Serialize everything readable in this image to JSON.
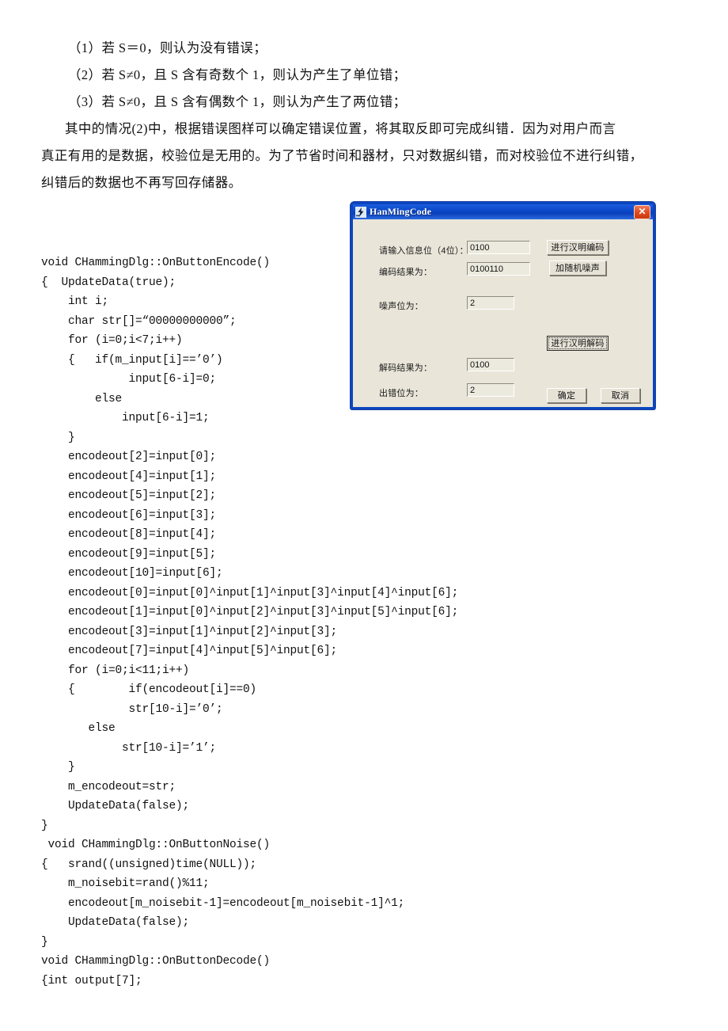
{
  "document": {
    "prose_lines": [
      {
        "text": "（1）若 S＝0，则认为没有错误；",
        "indent": "indent2"
      },
      {
        "text": "（2）若 S≠0，且 S 含有奇数个 1，则认为产生了单位错；",
        "indent": "indent2"
      },
      {
        "text": "（3）若 S≠0，且 S 含有偶数个 1，则认为产生了两位错；",
        "indent": "indent2"
      },
      {
        "text": "其中的情况(2)中，根据错误图样可以确定错误位置，将其取反即可完成纠错．因为对用户而言",
        "indent": "indent1"
      },
      {
        "text": "真正有用的是数据，校验位是无用的。为了节省时间和器材，只对数据纠错，而对校验位不进行纠错，",
        "indent": "flush"
      },
      {
        "text": "纠错后的数据也不再写回存储器。",
        "indent": "flush"
      }
    ],
    "code_lines": [
      "void CHammingDlg::OnButtonEncode()",
      "{  UpdateData(true);",
      "    int i;",
      "    char str[]=“00000000000”;",
      "    for (i=0;i<7;i++)",
      "    {   if(m_input[i]==’0’)",
      "             input[6-i]=0;",
      "        else",
      "            input[6-i]=1;",
      "    }",
      "    encodeout[2]=input[0];",
      "    encodeout[4]=input[1];",
      "    encodeout[5]=input[2];",
      "    encodeout[6]=input[3];",
      "    encodeout[8]=input[4];",
      "    encodeout[9]=input[5];",
      "    encodeout[10]=input[6];",
      "    encodeout[0]=input[0]^input[1]^input[3]^input[4]^input[6];",
      "    encodeout[1]=input[0]^input[2]^input[3]^input[5]^input[6];",
      "    encodeout[3]=input[1]^input[2]^input[3];",
      "    encodeout[7]=input[4]^input[5]^input[6];",
      "    for (i=0;i<11;i++)",
      "    {        if(encodeout[i]==0)",
      "             str[10-i]=’0’;",
      "       else",
      "            str[10-i]=’1’;",
      "    }",
      "    m_encodeout=str;",
      "    UpdateData(false);",
      "}",
      " void CHammingDlg::OnButtonNoise()",
      "{   srand((unsigned)time(NULL));",
      "    m_noisebit=rand()%11;",
      "    encodeout[m_noisebit-1]=encodeout[m_noisebit-1]^1;",
      "    UpdateData(false);",
      "}",
      "void CHammingDlg::OnButtonDecode()",
      "{int output[7];"
    ]
  },
  "dialog": {
    "title": "HanMingCode",
    "title_icon": "app-lightning-icon",
    "close_label": "✕",
    "accent_color": "#0a46c8",
    "face_color": "#e9e5d9",
    "fields": [
      {
        "label": "请输入信息位（4位）：",
        "value": "0100"
      },
      {
        "label": "编码结果为：",
        "value": "0100110"
      },
      {
        "label": "噪声位为：",
        "value": "2"
      },
      {
        "label": "解码结果为：",
        "value": "0100"
      },
      {
        "label": "出错位为：",
        "value": "2"
      }
    ],
    "buttons": [
      {
        "label": "进行汉明编码",
        "focused": false
      },
      {
        "label": "加随机噪声",
        "focused": false
      },
      {
        "label": "进行汉明解码",
        "focused": true
      },
      {
        "label": "确定",
        "focused": false
      },
      {
        "label": "取消",
        "focused": false
      }
    ]
  }
}
